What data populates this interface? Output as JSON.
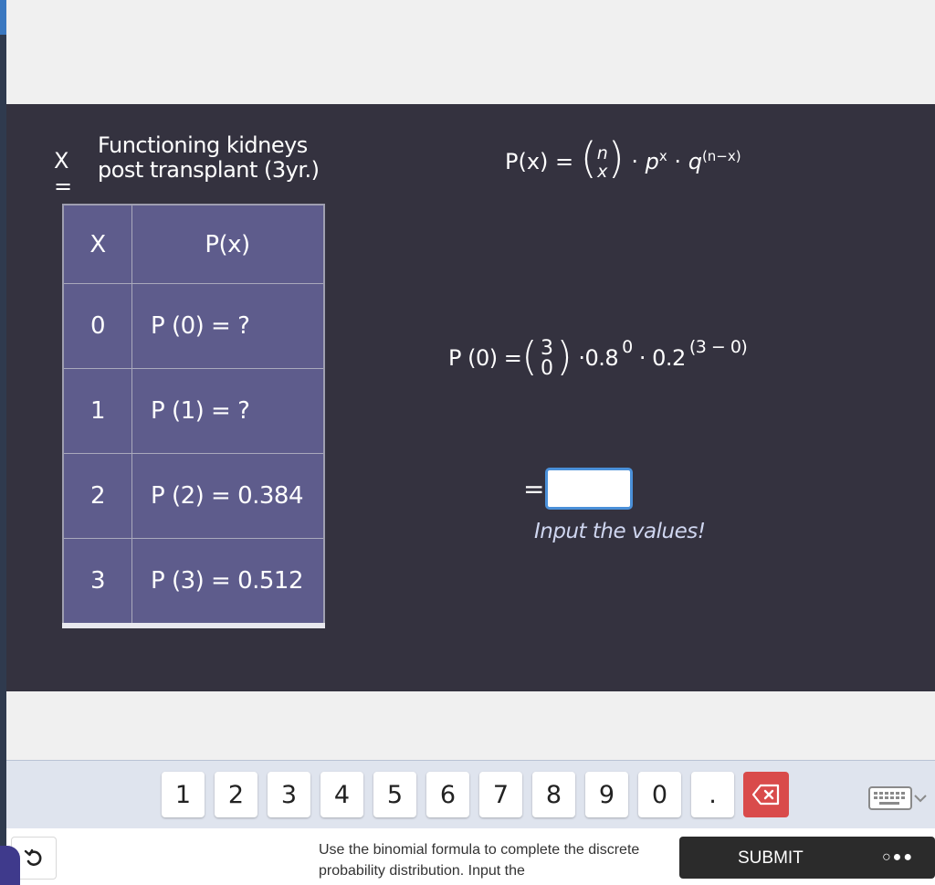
{
  "variable": {
    "symbol": "X =",
    "definition_line1": "Functioning kidneys",
    "definition_line2": "post transplant (3yr.)"
  },
  "formula": {
    "lhs": "P(x) =",
    "binom_top": "n",
    "binom_bottom": "x",
    "dot1": "·",
    "p_base": "p",
    "p_exp": "x",
    "dot2": "·",
    "q_base": "q",
    "q_exp": "(n−x)"
  },
  "table": {
    "headers": [
      "X",
      "P(x)"
    ],
    "rows": [
      {
        "x": "0",
        "p": "P (0) = ?"
      },
      {
        "x": "1",
        "p": "P (1) = ?"
      },
      {
        "x": "2",
        "p": "P (2) = 0.384"
      },
      {
        "x": "3",
        "p": "P (3) = 0.512"
      }
    ]
  },
  "equation": {
    "lhs": "P (0) =",
    "open": "(",
    "binom_top": "3",
    "binom_bottom": "0",
    "close": ")",
    "dot1": "·",
    "p_val": "0.8",
    "p_exp": "0",
    "dot2": "·",
    "q_val": "0.2",
    "q_exp": "(3 − 0)"
  },
  "answer": {
    "equals": "=",
    "value": "",
    "hint": "Input the values!"
  },
  "keypad": {
    "keys": [
      "1",
      "2",
      "3",
      "4",
      "5",
      "6",
      "7",
      "8",
      "9",
      "0",
      "."
    ]
  },
  "footer": {
    "instruction": "Use the binomial formula to complete the discrete probability distribution. Input the",
    "submit_label": "SUBMIT",
    "more_dots": "○●●"
  },
  "colors": {
    "panel_bg": "#34323f",
    "table_bg": "#5e5c8c",
    "hint": "#cfd6f0",
    "backspace": "#d94b4b",
    "submit_bg": "#2b2b2b",
    "input_border": "#4a90d9"
  },
  "icons": {
    "backspace": "backspace-icon",
    "keyboard": "keyboard-icon",
    "reset": "undo-icon"
  }
}
